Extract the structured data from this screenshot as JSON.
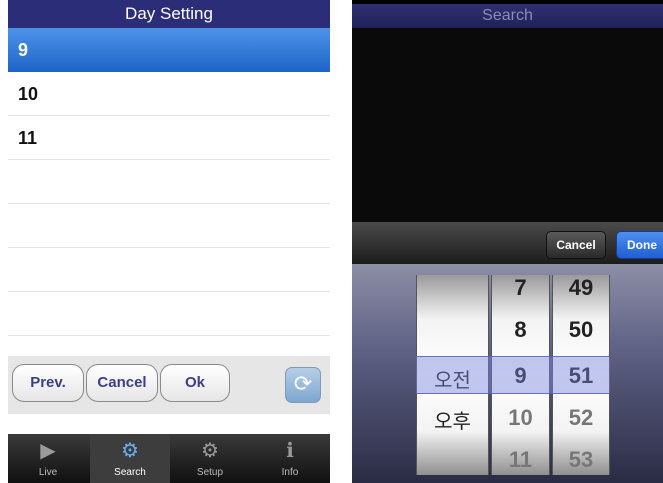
{
  "left": {
    "title": "Day Setting",
    "days": [
      "9",
      "10",
      "11"
    ],
    "selected_day": "9",
    "buttons": {
      "prev": "Prev.",
      "cancel": "Cancel",
      "ok": "Ok"
    },
    "tabs": [
      {
        "label": "Live",
        "icon": "play-icon"
      },
      {
        "label": "Search",
        "icon": "gear-icon"
      },
      {
        "label": "Setup",
        "icon": "gear-icon"
      },
      {
        "label": "Info",
        "icon": "info-icon"
      }
    ],
    "active_tab": "Search"
  },
  "right": {
    "title": "Search",
    "buttons": {
      "cancel": "Cancel",
      "done": "Done"
    },
    "picker": {
      "ampm": [
        "오전",
        "오후"
      ],
      "hours": [
        "7",
        "8",
        "9",
        "10",
        "11"
      ],
      "minutes": [
        "49",
        "50",
        "51",
        "52",
        "53"
      ],
      "selected": {
        "ampm": "오전",
        "hour": "9",
        "minute": "51"
      }
    }
  },
  "colors": {
    "title_bar": "#2b2d78",
    "selection_blue": "#1d64c7",
    "done_blue": "#1f5fd2",
    "button_text": "#3b3f86"
  }
}
